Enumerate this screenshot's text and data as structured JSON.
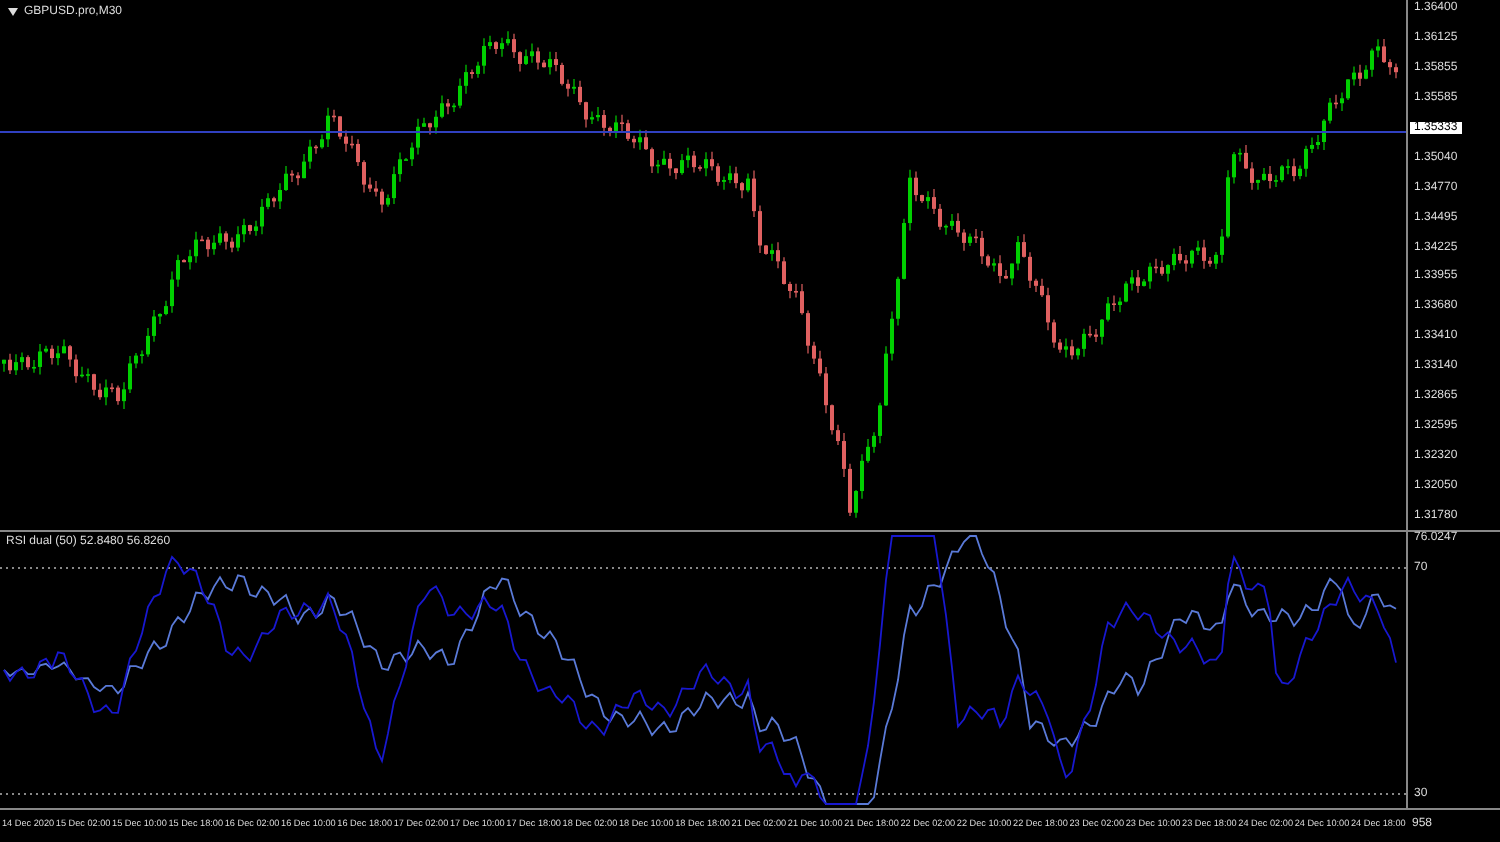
{
  "symbol_label": "GBPUSD.pro,M30",
  "price_axis": {
    "labels": [
      "1.36400",
      "1.36125",
      "1.35855",
      "1.35585",
      "1.35040",
      "1.34770",
      "1.34495",
      "1.34225",
      "1.33955",
      "1.33680",
      "1.33410",
      "1.33140",
      "1.32865",
      "1.32595",
      "1.32320",
      "1.32050",
      "1.31780"
    ],
    "current_price": "1.35333"
  },
  "indicator": {
    "label": "RSI dual (50) 52.8480 56.8260",
    "axis_labels": [
      {
        "text": "76.0247",
        "kind": "max"
      },
      {
        "text": "70",
        "kind": "level"
      },
      {
        "text": "30",
        "kind": "level"
      },
      {
        "text": "958",
        "kind": "min"
      }
    ]
  },
  "time_axis": {
    "labels": [
      "14 Dec 2020",
      "15 Dec 02:00",
      "15 Dec 10:00",
      "15 Dec 18:00",
      "16 Dec 02:00",
      "16 Dec 10:00",
      "16 Dec 18:00",
      "17 Dec 02:00",
      "17 Dec 10:00",
      "17 Dec 18:00",
      "18 Dec 02:00",
      "18 Dec 10:00",
      "18 Dec 18:00",
      "21 Dec 02:00",
      "21 Dec 10:00",
      "21 Dec 18:00",
      "22 Dec 02:00",
      "22 Dec 10:00",
      "22 Dec 18:00",
      "23 Dec 02:00",
      "23 Dec 10:00",
      "23 Dec 18:00",
      "24 Dec 02:00",
      "24 Dec 10:00",
      "24 Dec 18:00"
    ]
  }
}
